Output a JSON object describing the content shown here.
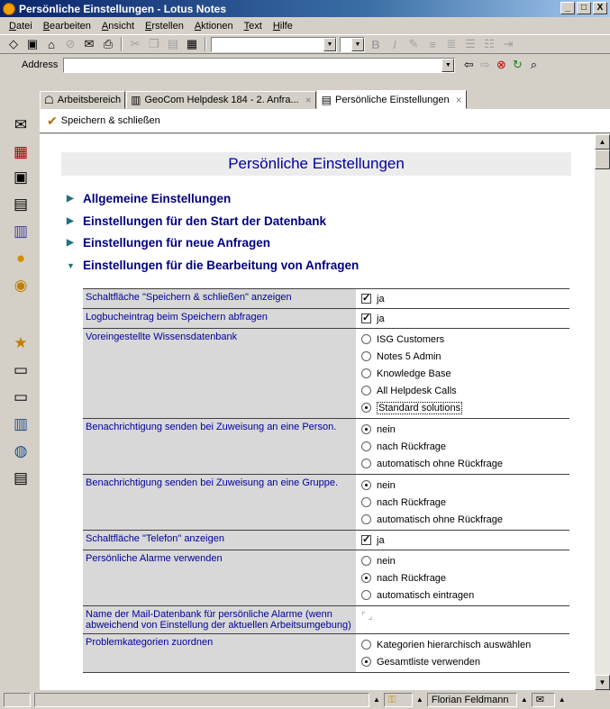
{
  "window": {
    "title": "Persönliche Einstellungen - Lotus Notes",
    "btn_min": "_",
    "btn_max": "□",
    "btn_close": "X"
  },
  "menu": [
    "Datei",
    "Bearbeiten",
    "Ansicht",
    "Erstellen",
    "Aktionen",
    "Text",
    "Hilfe"
  ],
  "address": {
    "label": "Address",
    "value": ""
  },
  "tabs": [
    {
      "label": "Arbeitsbereich"
    },
    {
      "label": "GeoCom Helpdesk 184 - 2. Anfra...",
      "close": "×"
    },
    {
      "label": "Persönliche Einstellungen",
      "close": "×"
    }
  ],
  "action_bar": {
    "save_close": "Speichern & schließen"
  },
  "page": {
    "heading": "Persönliche Einstellungen"
  },
  "sections": [
    {
      "label": "Allgemeine Einstellungen",
      "expanded": false
    },
    {
      "label": "Einstellungen für den Start der Datenbank",
      "expanded": false
    },
    {
      "label": "Einstellungen für neue Anfragen",
      "expanded": false
    },
    {
      "label": "Einstellungen für die Bearbeitung von Anfragen",
      "expanded": true
    }
  ],
  "settings": {
    "r0": {
      "label": "Schaltfläche \"Speichern & schließen\" anzeigen",
      "o0": "ja"
    },
    "r1": {
      "label": "Logbucheintrag beim Speichern abfragen",
      "o0": "ja"
    },
    "r2": {
      "label": "Voreingestellte Wissensdatenbank",
      "o0": "ISG Customers",
      "o1": "Notes 5 Admin",
      "o2": "Knowledge Base",
      "o3": "All Helpdesk Calls",
      "o4": "Standard solutions"
    },
    "r3": {
      "label": "Benachrichtigung senden bei Zuweisung an eine Person.",
      "o0": "nein",
      "o1": "nach Rückfrage",
      "o2": "automatisch ohne Rückfrage"
    },
    "r4": {
      "label": "Benachrichtigung senden bei Zuweisung an eine Gruppe.",
      "o0": "nein",
      "o1": "nach Rückfrage",
      "o2": "automatisch ohne Rückfrage"
    },
    "r5": {
      "label": "Schaltfläche \"Telefon\" anzeigen",
      "o0": "ja"
    },
    "r6": {
      "label": "Persönliche Alarme verwenden",
      "o0": "nein",
      "o1": "nach Rückfrage",
      "o2": "automatisch eintragen"
    },
    "r7": {
      "label": "Name der Mail-Datenbank für persönliche Alarme (wenn abweichend von Einstellung der aktuellen Arbeitsumgebung)",
      "value": ""
    },
    "r8": {
      "label": "Problemkategorien zuordnen",
      "o0": "Kategorien hierarchisch auswählen",
      "o1": "Gesamtliste verwenden"
    }
  },
  "selected": {
    "r0": true,
    "r1": true,
    "r2": "Standard solutions",
    "r3": "nein",
    "r4": "nein",
    "r5": true,
    "r6": "nach Rückfrage",
    "r8": "Gesamtliste verwenden"
  },
  "status": {
    "user": "Florian Feldmann"
  }
}
